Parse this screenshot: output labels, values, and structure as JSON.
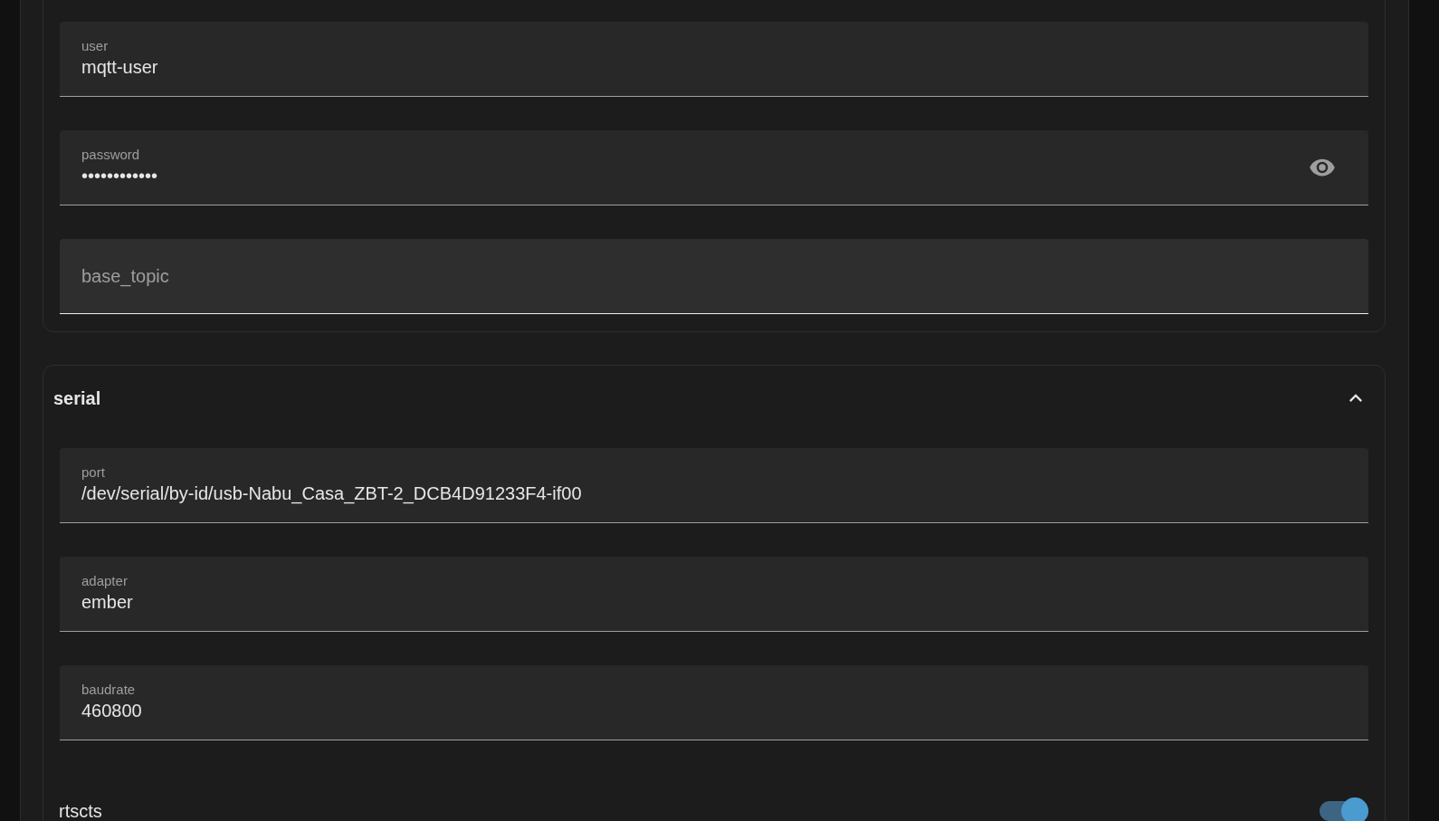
{
  "mqtt": {
    "fields": [
      {
        "label": "user",
        "value": "mqtt-user",
        "hovered": false
      },
      {
        "label": "password",
        "value": "••••••••••••",
        "kind": "password",
        "hovered": false
      },
      {
        "label": "base_topic",
        "hovered": true
      }
    ]
  },
  "serial": {
    "title": "serial",
    "expanded": true,
    "fields": [
      {
        "label": "port",
        "value": "/dev/serial/by-id/usb-Nabu_Casa_ZBT-2_DCB4D91233F4-if00",
        "hovered": false
      },
      {
        "label": "adapter",
        "value": "ember",
        "hovered": false
      },
      {
        "label": "baudrate",
        "value": "460800",
        "hovered": false
      }
    ],
    "toggles": [
      {
        "label": "rtscts",
        "on": true
      }
    ]
  }
}
